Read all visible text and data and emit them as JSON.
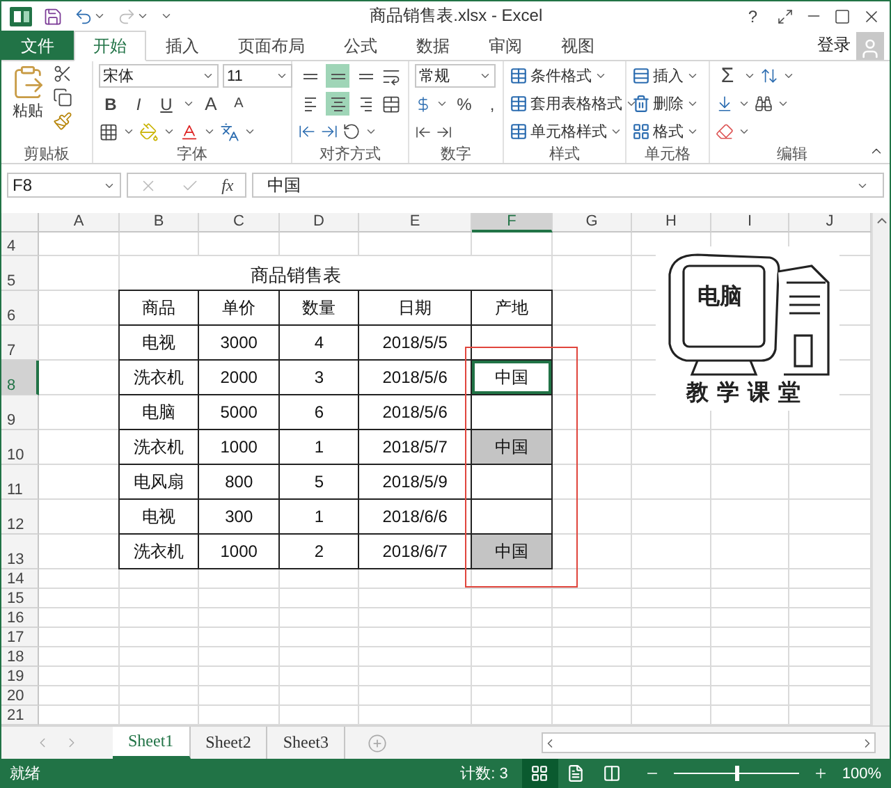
{
  "title_bar": {
    "title": "商品销售表.xlsx - Excel",
    "help": "?"
  },
  "tabs": [
    {
      "label": "文件",
      "kind": "file",
      "selected": false
    },
    {
      "label": "开始",
      "kind": "tab",
      "selected": true
    },
    {
      "label": "插入",
      "kind": "tab",
      "selected": false
    },
    {
      "label": "页面布局",
      "kind": "tab",
      "selected": false
    },
    {
      "label": "公式",
      "kind": "tab",
      "selected": false
    },
    {
      "label": "数据",
      "kind": "tab",
      "selected": false
    },
    {
      "label": "审阅",
      "kind": "tab",
      "selected": false
    },
    {
      "label": "视图",
      "kind": "tab",
      "selected": false
    }
  ],
  "sign_in": "登录",
  "ribbon": {
    "clipboard": {
      "label": "剪贴板",
      "paste": "粘贴"
    },
    "font": {
      "label": "字体",
      "name": "宋体",
      "size": "11",
      "styles": [
        "B",
        "I",
        "U"
      ],
      "grow": "A",
      "shrink": "A"
    },
    "alignment": {
      "label": "对齐方式",
      "buttons": [
        {
          "kind": "top",
          "selected": false
        },
        {
          "kind": "middle",
          "selected": true
        },
        {
          "kind": "bottom",
          "selected": false
        },
        {
          "kind": "left",
          "selected": false
        },
        {
          "kind": "center",
          "selected": true
        },
        {
          "kind": "right",
          "selected": false
        }
      ]
    },
    "number": {
      "label": "数字",
      "format": "常规",
      "percent": "%",
      "comma": ","
    },
    "styles": {
      "label": "样式",
      "items": [
        "条件格式",
        "套用表格格式",
        "单元格样式"
      ]
    },
    "cells": {
      "label": "单元格",
      "items": [
        "插入",
        "删除",
        "格式"
      ]
    },
    "editing": {
      "label": "编辑",
      "sum": "Σ"
    }
  },
  "formula_bar": {
    "name_box": "F8",
    "fx": "fx",
    "value": "中国"
  },
  "sheet": {
    "columns": [
      {
        "label": "A",
        "selected": false
      },
      {
        "label": "B",
        "selected": false
      },
      {
        "label": "C",
        "selected": false
      },
      {
        "label": "D",
        "selected": false
      },
      {
        "label": "E",
        "selected": false
      },
      {
        "label": "F",
        "selected": true
      },
      {
        "label": "G",
        "selected": false
      },
      {
        "label": "H",
        "selected": false
      },
      {
        "label": "I",
        "selected": false
      },
      {
        "label": "J",
        "selected": false
      }
    ],
    "rows": [
      {
        "label": "4",
        "selected": false
      },
      {
        "label": "5",
        "selected": false
      },
      {
        "label": "6",
        "selected": false
      },
      {
        "label": "7",
        "selected": false
      },
      {
        "label": "8",
        "selected": true
      },
      {
        "label": "9",
        "selected": false
      },
      {
        "label": "10",
        "selected": false
      },
      {
        "label": "11",
        "selected": false
      },
      {
        "label": "12",
        "selected": false
      },
      {
        "label": "13",
        "selected": false
      },
      {
        "label": "14",
        "selected": false
      },
      {
        "label": "15",
        "selected": false
      },
      {
        "label": "16",
        "selected": false
      },
      {
        "label": "17",
        "selected": false
      },
      {
        "label": "18",
        "selected": false
      },
      {
        "label": "19",
        "selected": false
      },
      {
        "label": "20",
        "selected": false
      },
      {
        "label": "21",
        "selected": false
      }
    ],
    "table": {
      "title": "商品销售表",
      "headers": [
        "商品",
        "单价",
        "数量",
        "日期",
        "产地"
      ],
      "rows": [
        {
          "cells": [
            "电视",
            "3000",
            "4",
            "2018/5/5"
          ],
          "selected": false,
          "highlighted": false
        },
        {
          "cells": [
            "洗衣机",
            "2000",
            "3",
            "2018/5/6"
          ],
          "origin": "中国",
          "selected": true,
          "highlighted": false
        },
        {
          "cells": [
            "电脑",
            "5000",
            "6",
            "2018/5/6"
          ],
          "selected": false,
          "highlighted": false
        },
        {
          "cells": [
            "洗衣机",
            "1000",
            "1",
            "2018/5/7"
          ],
          "origin": "中国",
          "selected": false,
          "highlighted": true
        },
        {
          "cells": [
            "电风扇",
            "800",
            "5",
            "2018/5/9"
          ],
          "selected": false,
          "highlighted": false
        },
        {
          "cells": [
            "电视",
            "300",
            "1",
            "2018/6/6"
          ],
          "selected": false,
          "highlighted": false
        },
        {
          "cells": [
            "洗衣机",
            "1000",
            "2",
            "2018/6/7"
          ],
          "origin": "中国",
          "selected": false,
          "highlighted": true
        }
      ]
    },
    "picture": {
      "screen_text": "电脑",
      "caption": "教学课堂"
    }
  },
  "sheet_tabs": [
    {
      "label": "Sheet1",
      "selected": true
    },
    {
      "label": "Sheet2",
      "selected": false
    },
    {
      "label": "Sheet3",
      "selected": false
    }
  ],
  "status_bar": {
    "status": "就绪",
    "count": "计数: 3",
    "views": [
      {
        "kind": "normal",
        "selected": true
      },
      {
        "kind": "layout",
        "selected": false
      },
      {
        "kind": "break",
        "selected": false
      }
    ],
    "zoom": {
      "level": 0.5,
      "reading": "100%"
    }
  }
}
